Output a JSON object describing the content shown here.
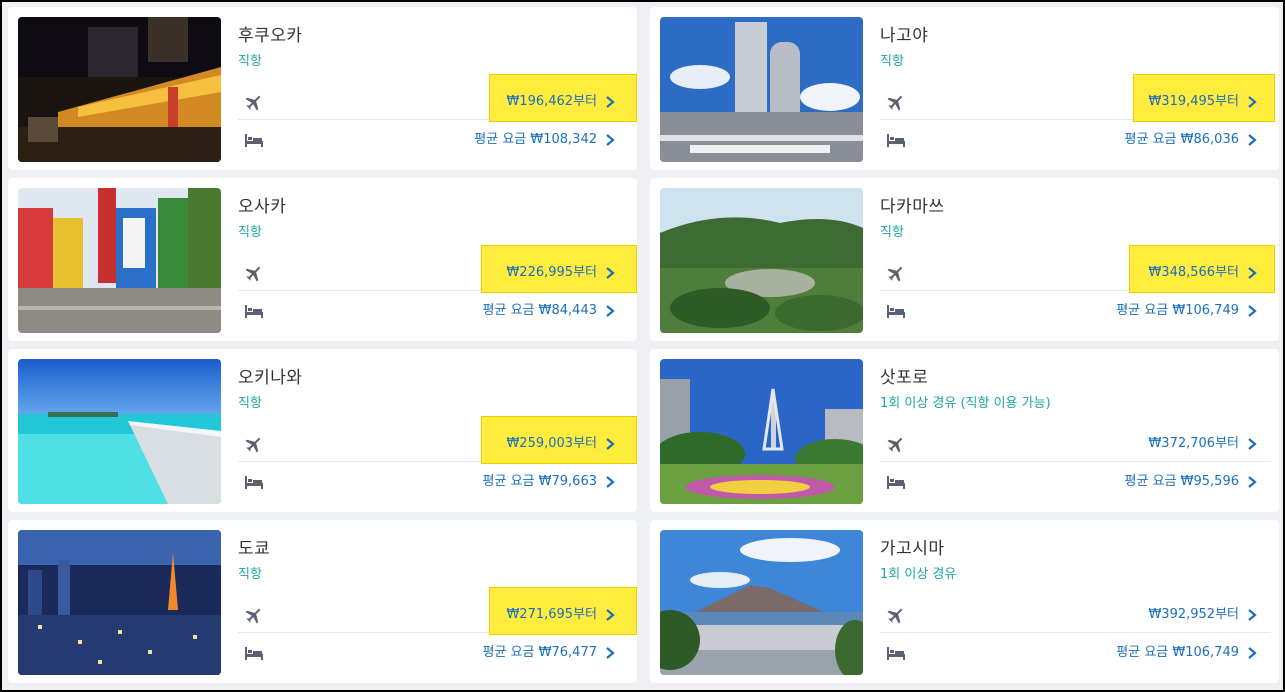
{
  "destinations": [
    {
      "city": "후쿠오카",
      "route": "직항",
      "flight_price": "₩196,462부터",
      "hotel_price": "평균 요금 ₩108,342",
      "highlighted": true,
      "photo": "fukuoka-yatai-night-photo"
    },
    {
      "city": "나고야",
      "route": "직항",
      "flight_price": "₩319,495부터",
      "hotel_price": "평균 요금 ₩86,036",
      "highlighted": true,
      "photo": "nagoya-towers-photo"
    },
    {
      "city": "오사카",
      "route": "직항",
      "flight_price": "₩226,995부터",
      "hotel_price": "평균 요금 ₩84,443",
      "highlighted": true,
      "photo": "osaka-dotonbori-photo"
    },
    {
      "city": "다카마쓰",
      "route": "직항",
      "flight_price": "₩348,566부터",
      "hotel_price": "평균 요금 ₩106,749",
      "highlighted": true,
      "photo": "takamatsu-garden-photo"
    },
    {
      "city": "오키나와",
      "route": "직항",
      "flight_price": "₩259,003부터",
      "hotel_price": "평균 요금 ₩79,663",
      "highlighted": true,
      "photo": "okinawa-sea-bridge-photo"
    },
    {
      "city": "삿포로",
      "route": "1회 이상 경유 (직항 이용 가능)",
      "flight_price": "₩372,706부터",
      "hotel_price": "평균 요금 ₩95,596",
      "highlighted": false,
      "photo": "sapporo-tv-tower-photo"
    },
    {
      "city": "도쿄",
      "route": "직항",
      "flight_price": "₩271,695부터",
      "hotel_price": "평균 요금 ₩76,477",
      "highlighted": true,
      "photo": "tokyo-night-skyline-photo"
    },
    {
      "city": "가고시마",
      "route": "1회 이상 경유",
      "flight_price": "₩392,952부터",
      "hotel_price": "평균 요금 ₩106,749",
      "highlighted": false,
      "photo": "kagoshima-sakurajima-photo"
    }
  ],
  "colors": {
    "route": "#1ea7a0",
    "price": "#1a6fbf",
    "highlight": "#ffec3d",
    "background": "#eef0f4"
  },
  "icons": {
    "flight": "airplane-icon",
    "hotel": "bed-icon",
    "chevron": "chevron-right-icon"
  }
}
